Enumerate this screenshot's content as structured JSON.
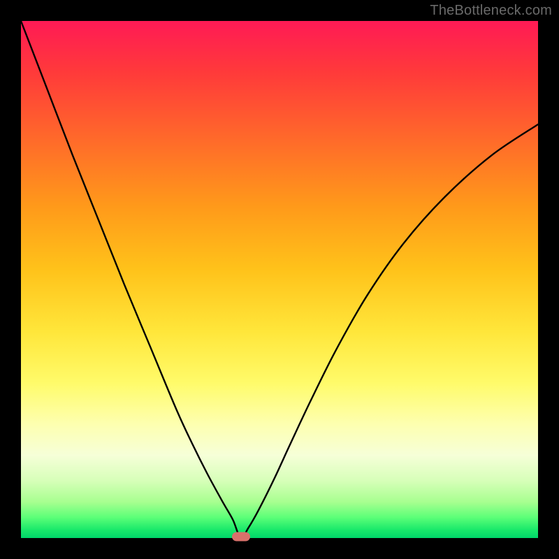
{
  "watermark": "TheBottleneck.com",
  "marker": {
    "x_fraction": 0.425
  },
  "chart_data": {
    "type": "line",
    "title": "",
    "xlabel": "",
    "ylabel": "",
    "xlim": [
      0,
      1
    ],
    "ylim": [
      0,
      1
    ],
    "annotations": [
      {
        "text": "TheBottleneck.com",
        "position": "top-right"
      }
    ],
    "series": [
      {
        "name": "bottleneck-curve",
        "x": [
          0.0,
          0.05,
          0.1,
          0.15,
          0.2,
          0.25,
          0.3,
          0.33,
          0.36,
          0.39,
          0.41,
          0.425,
          0.44,
          0.46,
          0.49,
          0.52,
          0.56,
          0.61,
          0.67,
          0.74,
          0.82,
          0.91,
          1.0
        ],
        "y": [
          1.0,
          0.87,
          0.74,
          0.615,
          0.49,
          0.37,
          0.25,
          0.185,
          0.125,
          0.07,
          0.035,
          0.0,
          0.02,
          0.055,
          0.115,
          0.18,
          0.265,
          0.365,
          0.47,
          0.57,
          0.66,
          0.74,
          0.8
        ]
      }
    ],
    "background_gradient": [
      {
        "stop": 0.0,
        "color": "#ff1a55"
      },
      {
        "stop": 0.5,
        "color": "#ffd23a"
      },
      {
        "stop": 0.85,
        "color": "#f6ffd8"
      },
      {
        "stop": 1.0,
        "color": "#00d66a"
      }
    ],
    "marker": {
      "x": 0.425,
      "y": 0.0,
      "color": "#d9716b"
    }
  }
}
